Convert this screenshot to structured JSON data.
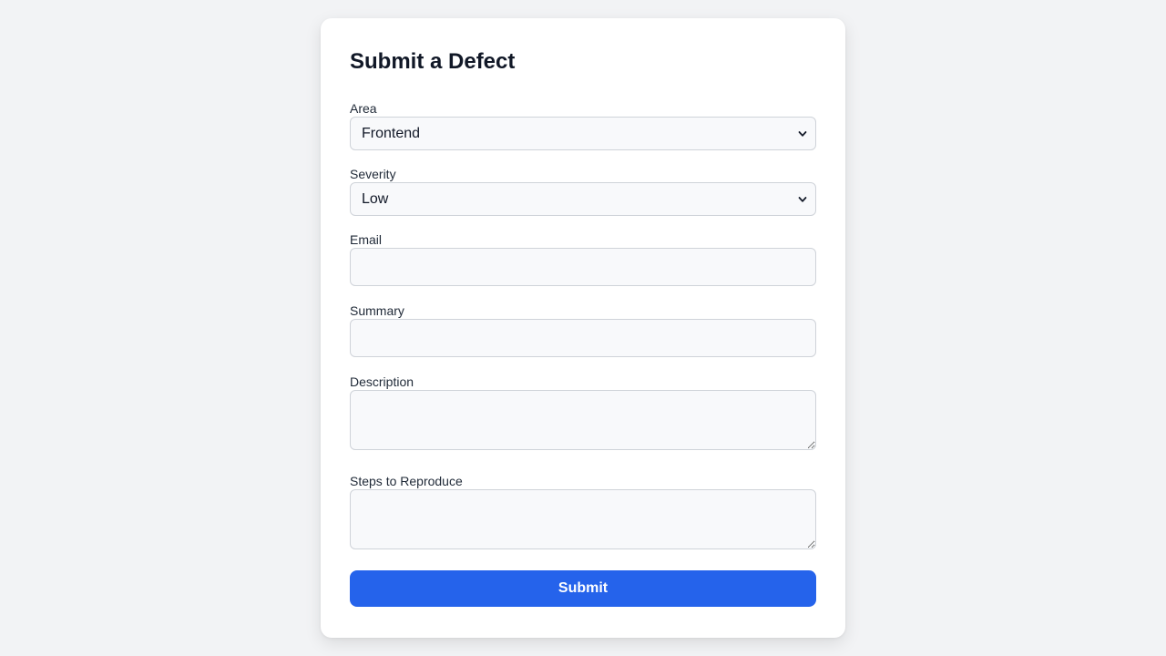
{
  "form": {
    "title": "Submit a Defect",
    "fields": {
      "area": {
        "label": "Area",
        "value": "Frontend"
      },
      "severity": {
        "label": "Severity",
        "value": "Low"
      },
      "email": {
        "label": "Email",
        "value": "",
        "placeholder": ""
      },
      "summary": {
        "label": "Summary",
        "value": "",
        "placeholder": ""
      },
      "description": {
        "label": "Description",
        "value": ""
      },
      "steps": {
        "label": "Steps to Reproduce",
        "value": ""
      }
    },
    "submit_label": "Submit"
  },
  "theme": {
    "accent": "#2563eb",
    "background": "#f2f3f5",
    "card": "#ffffff",
    "field_bg": "#f8f9fb",
    "field_border": "#cfd3d9"
  },
  "icons": {
    "select_indicator": "chevron-down-icon"
  }
}
